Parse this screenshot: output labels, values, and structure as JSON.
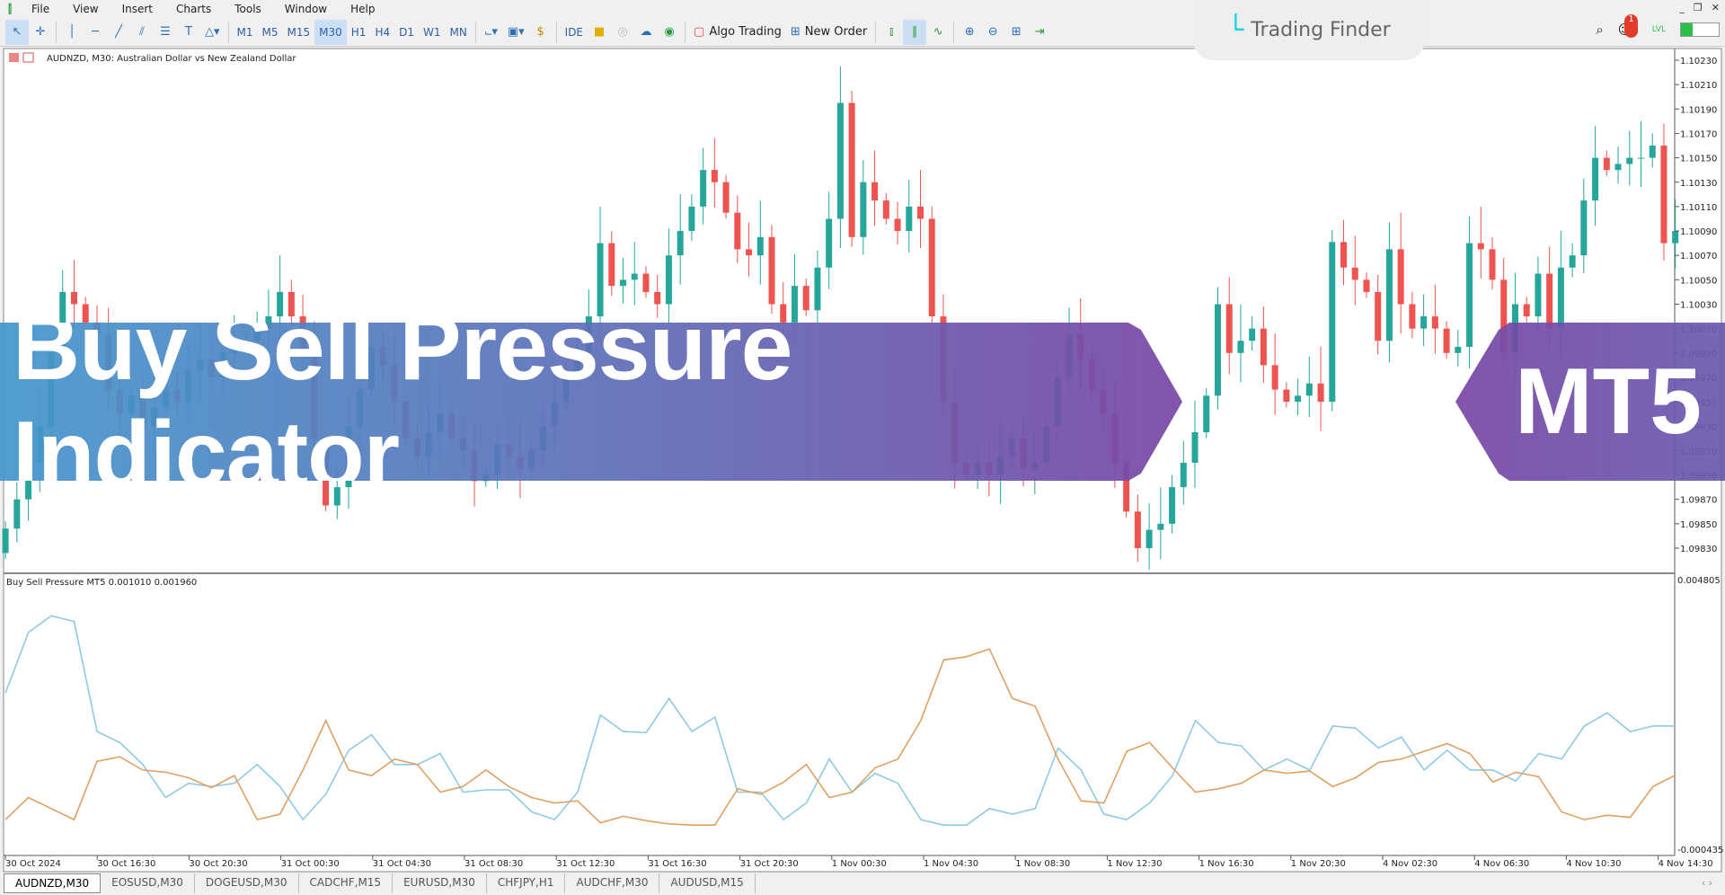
{
  "menu": {
    "items": [
      "File",
      "View",
      "Insert",
      "Charts",
      "Tools",
      "Window",
      "Help"
    ]
  },
  "toolbar": {
    "timeframes": [
      "M1",
      "M5",
      "M15",
      "M30",
      "H1",
      "H4",
      "D1",
      "W1",
      "MN"
    ],
    "active_timeframe": "M30",
    "ide": "IDE",
    "algo_trading": "Algo Trading",
    "new_order": "New Order"
  },
  "brand": {
    "name": "Trading Finder"
  },
  "notifications": {
    "count": "1"
  },
  "level": {
    "label": "LVL",
    "progress": 0.3
  },
  "chart": {
    "title": "AUDNZD, M30:  Australian Dollar vs New Zealand Dollar",
    "indicator_label": "Buy Sell Pressure MT5 0.001010 0.001960"
  },
  "banner": {
    "title": "Buy Sell Pressure Indicator",
    "tag": "MT5"
  },
  "tabs": [
    "AUDNZD,M30",
    "EOSUSD,M30",
    "DOGEUSD,M30",
    "CADCHF,M15",
    "EURUSD,M30",
    "CHFJPY,H1",
    "AUDCHF,M30",
    "AUDUSD,M15"
  ],
  "active_tab": "AUDNZD,M30",
  "colors": {
    "bull": "#26a69a",
    "bear": "#ef5350",
    "buy_line": "#8ecae6",
    "sell_line": "#e0a060"
  },
  "chart_data": [
    {
      "type": "candlestick",
      "symbol": "AUDNZD",
      "timeframe": "M30",
      "ylim": [
        1.0983,
        1.1023
      ],
      "y_ticks": [
        "1.10230",
        "1.10210",
        "1.10190",
        "1.10170",
        "1.10150",
        "1.10130",
        "1.10110",
        "1.10090",
        "1.10070",
        "1.10050",
        "1.10030",
        "1.10010",
        "1.09990",
        "1.09970",
        "1.09950",
        "1.09930",
        "1.09910",
        "1.09890",
        "1.09870",
        "1.09850",
        "1.09830"
      ],
      "x_ticks": [
        "30 Oct 2024",
        "30 Oct 16:30",
        "30 Oct 20:30",
        "31 Oct 00:30",
        "31 Oct 04:30",
        "31 Oct 08:30",
        "31 Oct 12:30",
        "31 Oct 16:30",
        "31 Oct 20:30",
        "1 Nov 00:30",
        "1 Nov 04:30",
        "1 Nov 08:30",
        "1 Nov 12:30",
        "1 Nov 16:30",
        "1 Nov 20:30",
        "4 Nov 02:30",
        "4 Nov 06:30",
        "4 Nov 10:30",
        "4 Nov 14:30"
      ],
      "close": [
        1.09846,
        1.0987,
        1.099,
        1.0993,
        1.0999,
        1.1004,
        1.1003,
        1.10015,
        1.10005,
        1.0996,
        1.0994,
        1.09955,
        1.0993,
        1.09945,
        1.0996,
        1.0995,
        1.09975,
        1.09985,
        1.0997,
        1.0999,
        1.09995,
        1.1,
        1.1001,
        1.1002,
        1.1004,
        1.1002,
        1.0999,
        1.0992,
        1.09865,
        1.0988,
        1.0993,
        1.0996,
        1.09995,
        1.0998,
        1.0995,
        1.0992,
        1.09905,
        1.09925,
        1.0994,
        1.0992,
        1.0991,
        1.09885,
        1.0989,
        1.09915,
        1.09905,
        1.09895,
        1.0991,
        1.0993,
        1.0995,
        1.09975,
        1.0999,
        1.1002,
        1.1008,
        1.10045,
        1.1005,
        1.10055,
        1.1004,
        1.1003,
        1.1007,
        1.1009,
        1.1011,
        1.1014,
        1.1013,
        1.10105,
        1.10075,
        1.1007,
        1.10085,
        1.1003,
        1.10015,
        1.10045,
        1.10025,
        1.1006,
        1.101,
        1.10195,
        1.10085,
        1.1013,
        1.10115,
        1.101,
        1.1009,
        1.1011,
        1.101,
        1.1002,
        1.0995,
        1.099,
        1.0989,
        1.099,
        1.0989,
        1.09905,
        1.0992,
        1.09895,
        1.099,
        1.0993,
        1.0997,
        1.10005,
        1.09985,
        1.0996,
        1.0994,
        1.099,
        1.0986,
        1.0983,
        1.09845,
        1.0985,
        1.0988,
        1.099,
        1.09925,
        1.09955,
        1.1003,
        1.0999,
        1.1,
        1.1001,
        1.0998,
        1.0996,
        1.0995,
        1.09955,
        1.09965,
        1.0995,
        1.10081,
        1.1006,
        1.1005,
        1.1004,
        1.1,
        1.10075,
        1.1003,
        1.1001,
        1.1002,
        1.1001,
        1.0999,
        1.09995,
        1.1008,
        1.10075,
        1.1005,
        1.0999,
        1.1003,
        1.1002,
        1.10055,
        1.1001,
        1.1006,
        1.1007,
        1.10115,
        1.1015,
        1.1014,
        1.10145,
        1.1015,
        1.1015,
        1.1016,
        1.1008,
        1.1009
      ]
    },
    {
      "type": "line",
      "name": "Buy Sell Pressure MT5",
      "ylim": [
        -0.000435,
        0.004805
      ],
      "y_ticks": [
        "0.004805",
        "-0.000435"
      ],
      "series": [
        {
          "color": "#8ecae6",
          "values": [
            0.002601,
            0.003778,
            0.004099,
            0.003992,
            0.001852,
            0.001638,
            0.00121,
            0.000568,
            0.000846,
            0.000782,
            0.000846,
            0.00121,
            0.000782,
            0.00014,
            0.000632,
            0.001488,
            0.001788,
            0.00121,
            0.00121,
            0.001424,
            0.000675,
            0.000718,
            0.000718,
            0.00029,
            0.00014,
            0.000675,
            0.002173,
            0.001852,
            0.001831,
            0.002494,
            0.001852,
            0.00213,
            0.000675,
            0.000675,
            0.00014,
            0.000461,
            0.001317,
            0.000675,
            0.001039,
            0.000846,
            0.00014,
            3.3e-05,
            3.3e-05,
            0.000354,
            0.000247,
            0.000354,
            0.001531,
            0.001103,
            0.000247,
            0.00014,
            0.000461,
            0.000996,
            0.002066,
            0.001638,
            0.001574,
            0.001103,
            0.001317,
            0.001103,
            0.001959,
            0.001916,
            0.001531,
            0.001745,
            0.001103,
            0.001488,
            0.001103,
            0.001103,
            0.000889,
            0.001424,
            0.001317,
            0.001959,
            0.002216,
            0.001852,
            0.001959,
            0.00196
          ]
        },
        {
          "color": "#e0a060",
          "values": [
            0.00014,
            0.000568,
            0.000354,
            0.00014,
            0.001274,
            0.00136,
            0.001103,
            0.00106,
            0.000953,
            0.00076,
            0.000996,
            0.00014,
            0.000247,
            0.001103,
            0.002066,
            0.001103,
            0.000996,
            0.001317,
            0.00121,
            0.000675,
            0.000782,
            0.001103,
            0.000782,
            0.000568,
            0.000461,
            0.000504,
            7.6e-05,
            0.000204,
            0.000119,
            5.5e-05,
            3.3e-05,
            3.3e-05,
            0.000739,
            0.000632,
            0.000868,
            0.00121,
            0.000568,
            0.000675,
            0.001145,
            0.001317,
            0.002066,
            0.003243,
            0.003307,
            0.003457,
            0.002494,
            0.002344,
            0.001317,
            0.000504,
            0.000461,
            0.001467,
            0.001638,
            0.001145,
            0.000675,
            0.000739,
            0.000846,
            0.001103,
            0.001039,
            0.001082,
            0.000782,
            0.000953,
            0.001252,
            0.001317,
            0.001467,
            0.001617,
            0.001424,
            0.000868,
            0.00106,
            0.000975,
            0.00029,
            0.00014,
            0.000226,
            0.000183,
            0.000782,
            0.00101
          ]
        }
      ]
    }
  ]
}
